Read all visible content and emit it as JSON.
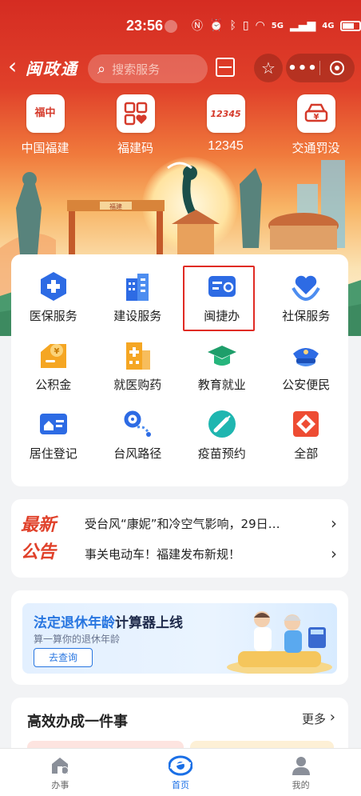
{
  "status_bar": {
    "time": "23:56",
    "network_label": "5G",
    "network2_label": "4G"
  },
  "nav": {
    "back_icon": "chevron-left-icon",
    "app_title": "闽政通",
    "search_placeholder": "搜索服务"
  },
  "quick_links": [
    {
      "label": "中国福建",
      "icon_text": "福中"
    },
    {
      "label": "福建码",
      "icon_text": "码"
    },
    {
      "label": "12345",
      "icon_text": "12345"
    },
    {
      "label": "交通罚没",
      "icon_text": "¥"
    }
  ],
  "scene": {
    "gate_sign": "福建",
    "colors": {
      "sun": "#fff8e0",
      "roof": "#d8843a",
      "tree": "#4a9a6e"
    }
  },
  "services": [
    {
      "label": "医保服务",
      "icon": "medical-insurance-icon"
    },
    {
      "label": "建设服务",
      "icon": "building-icon"
    },
    {
      "label": "闽捷办",
      "icon": "id-card-icon"
    },
    {
      "label": "社保服务",
      "icon": "heart-hands-icon"
    },
    {
      "label": "公积金",
      "icon": "housing-fund-icon"
    },
    {
      "label": "就医购药",
      "icon": "hospital-icon"
    },
    {
      "label": "教育就业",
      "icon": "graduation-cap-icon"
    },
    {
      "label": "公安便民",
      "icon": "police-cap-icon"
    },
    {
      "label": "居住登记",
      "icon": "residence-card-icon"
    },
    {
      "label": "台风路径",
      "icon": "typhoon-icon"
    },
    {
      "label": "疫苗预约",
      "icon": "vaccine-icon"
    },
    {
      "label": "全部",
      "icon": "all-grid-icon"
    }
  ],
  "notice": {
    "tag_line1": "最新",
    "tag_line2": "公告",
    "items": [
      "受台风“康妮”和冷空气影响，29日…",
      "事关电动车！福建发布新规！"
    ]
  },
  "banner": {
    "title_em": "法定退休年龄",
    "title_rest": "计算器上线",
    "subtitle": "算一算你的退休年龄",
    "button": "去查询"
  },
  "efficient": {
    "title": "高效办成一件事",
    "more": "更多"
  },
  "tabbar": [
    {
      "label": "办事",
      "icon": "service-hall-icon",
      "active": false
    },
    {
      "label": "首页",
      "icon": "home-logo-icon",
      "active": true
    },
    {
      "label": "我的",
      "icon": "user-icon",
      "active": false
    }
  ],
  "colors": {
    "brand_red": "#d52c22",
    "accent_blue": "#1a6fe6",
    "highlight_red": "#e02b24",
    "notice_orange": "#e0412a"
  }
}
